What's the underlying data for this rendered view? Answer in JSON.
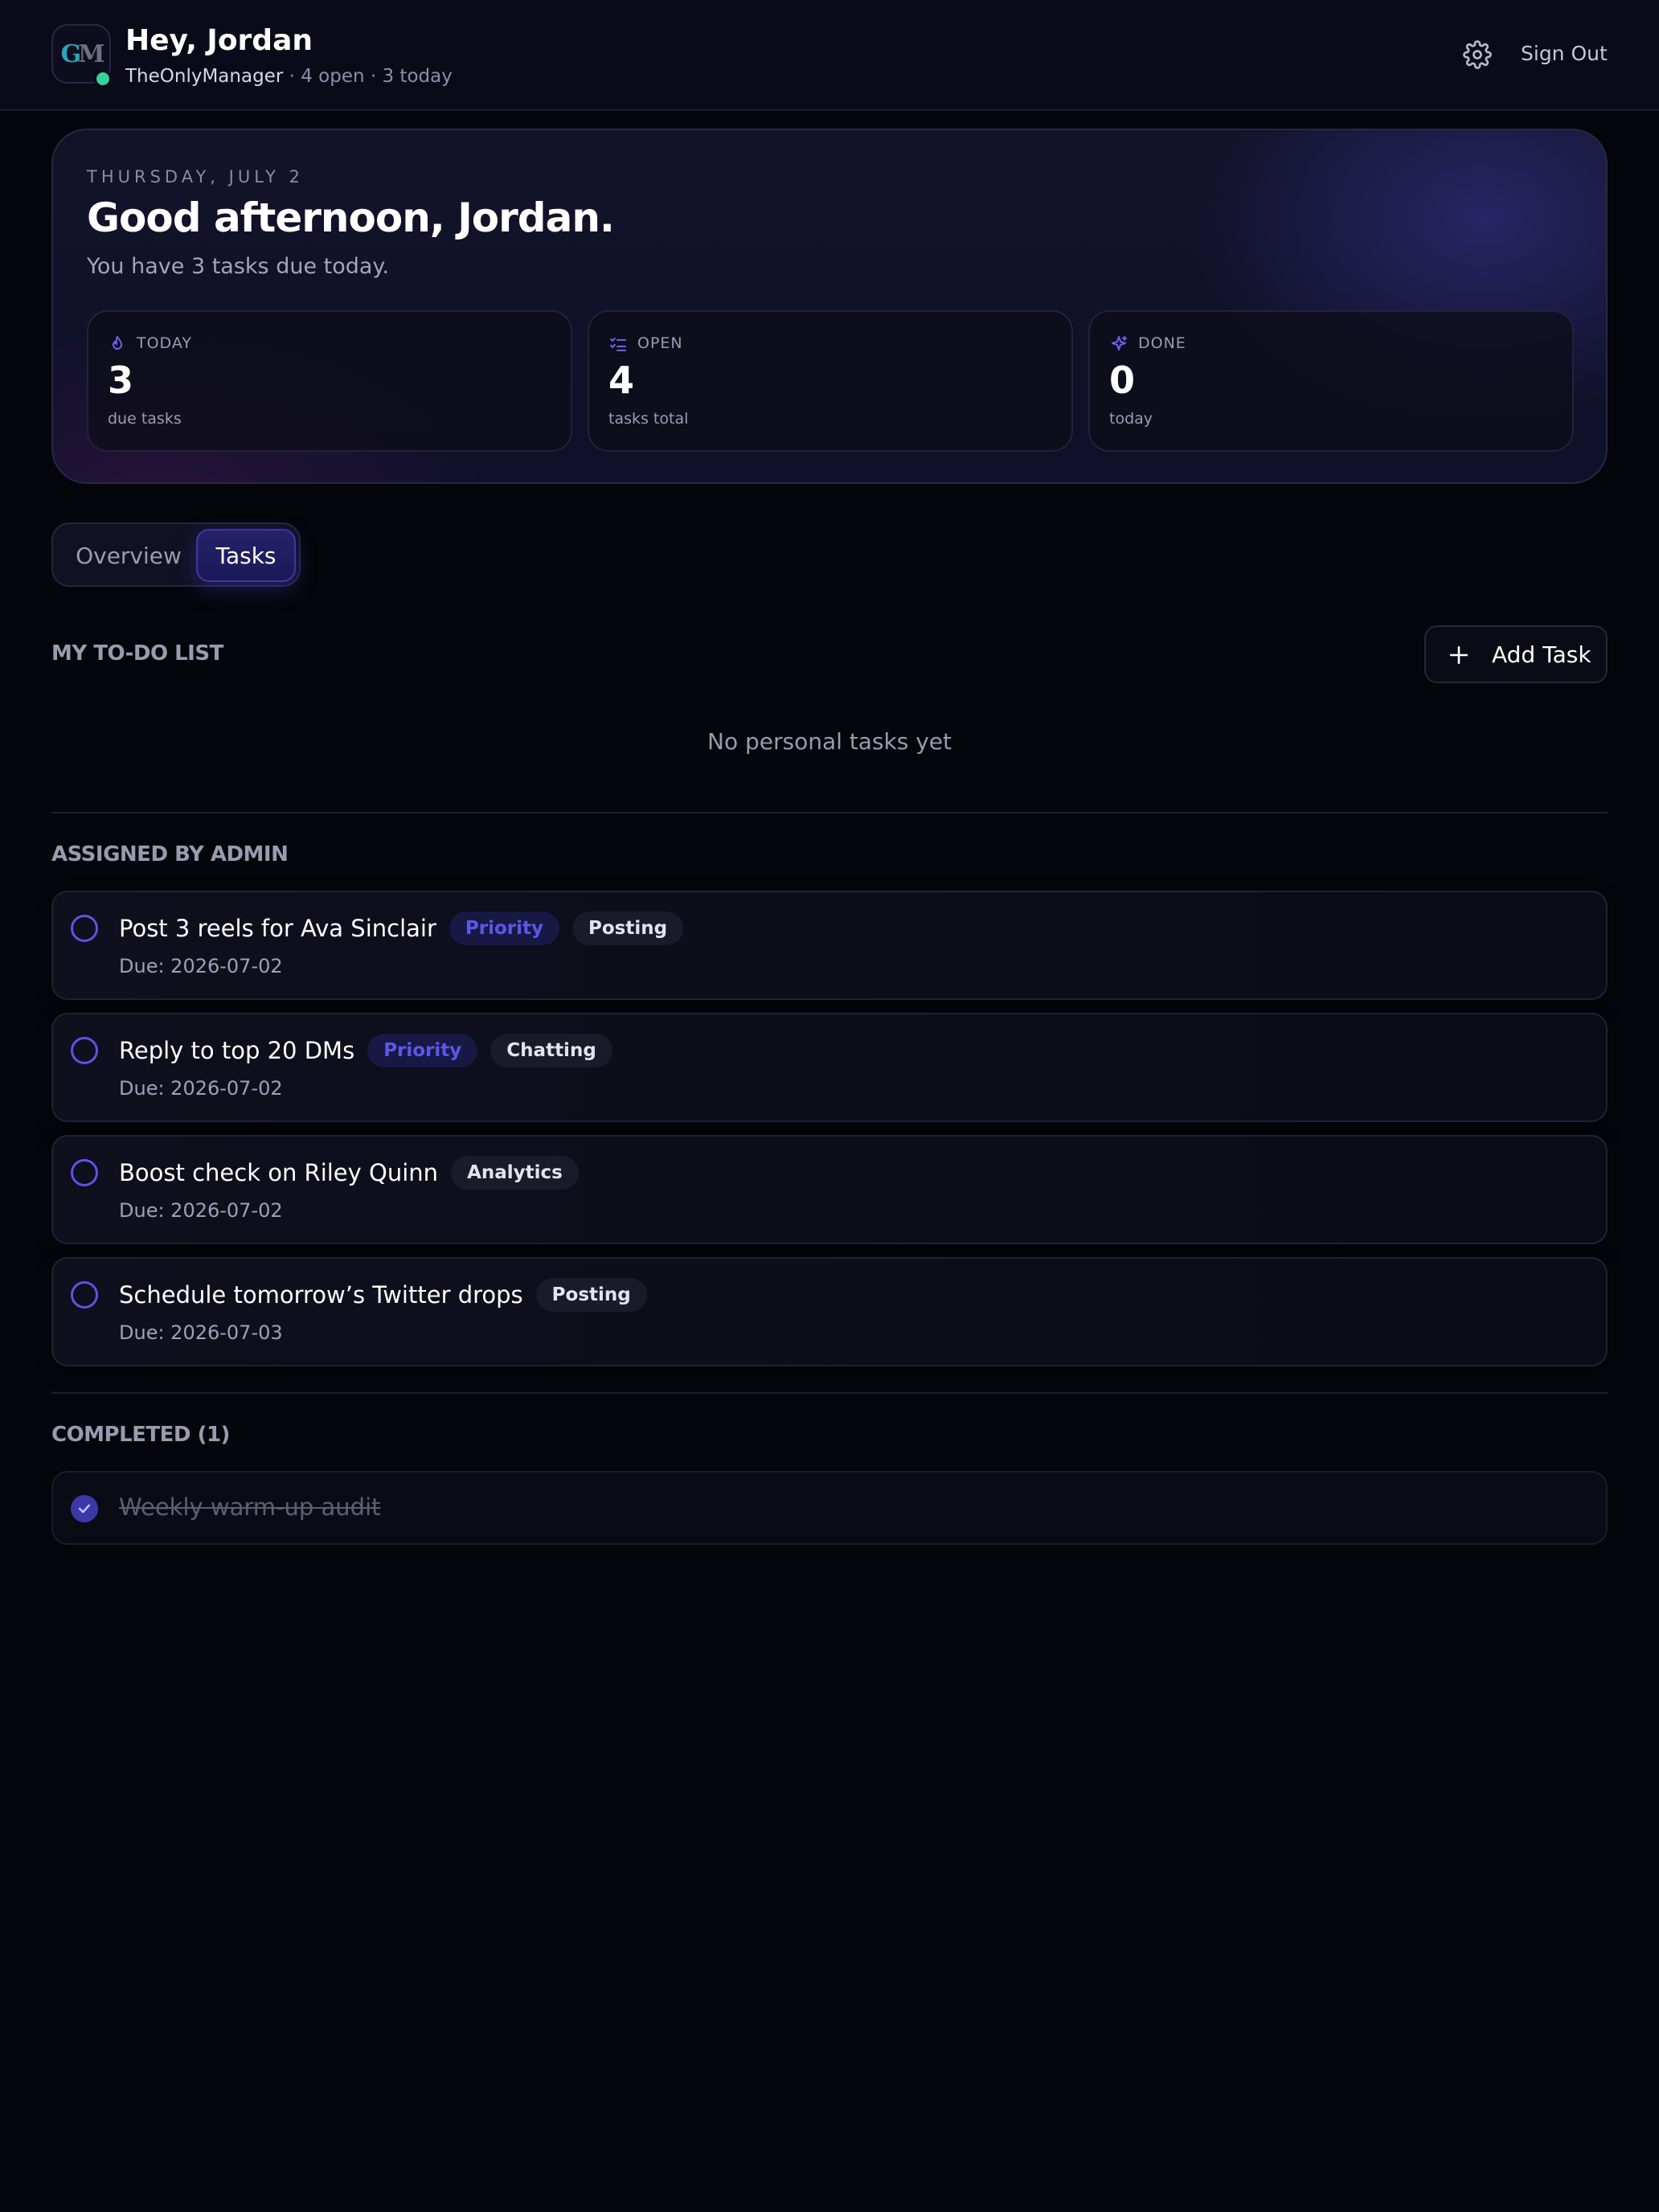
{
  "header": {
    "logo_text_g": "G",
    "logo_text_m": "M",
    "greeting": "Hey, Jordan",
    "brand": "TheOnlyManager",
    "summary": " · 4 open · 3 today",
    "settings_icon": "gear-icon",
    "signout_label": "Sign Out"
  },
  "hero": {
    "date": "THURSDAY, JULY 2",
    "title": "Good afternoon, Jordan.",
    "subtitle": "You have 3 tasks due today.",
    "stats": [
      {
        "icon": "flame-icon",
        "label": "TODAY",
        "value": "3",
        "desc": "due tasks"
      },
      {
        "icon": "checklist-icon",
        "label": "OPEN",
        "value": "4",
        "desc": "tasks total"
      },
      {
        "icon": "sparkle-icon",
        "label": "DONE",
        "value": "0",
        "desc": "today"
      }
    ]
  },
  "tabs": {
    "overview": "Overview",
    "tasks": "Tasks",
    "active": "Tasks"
  },
  "todo": {
    "title": "MY TO-DO LIST",
    "add_label": "Add Task",
    "empty": "No personal tasks yet"
  },
  "assigned": {
    "title": "ASSIGNED BY ADMIN",
    "tasks": [
      {
        "title": "Post 3 reels for Ava Sinclair",
        "tags": [
          "Priority",
          "Posting"
        ],
        "due": "Due: 2026-07-02"
      },
      {
        "title": "Reply to top 20 DMs",
        "tags": [
          "Priority",
          "Chatting"
        ],
        "due": "Due: 2026-07-02"
      },
      {
        "title": "Boost check on Riley Quinn",
        "tags": [
          "Analytics"
        ],
        "due": "Due: 2026-07-02"
      },
      {
        "title": "Schedule tomorrow’s Twitter drops",
        "tags": [
          "Posting"
        ],
        "due": "Due: 2026-07-03"
      }
    ]
  },
  "completed": {
    "title": "COMPLETED (1)",
    "tasks": [
      {
        "title": "Weekly warm-up audit"
      }
    ]
  },
  "colors": {
    "accent": "#5c57e8",
    "online": "#34d399",
    "background": "#05060b"
  }
}
